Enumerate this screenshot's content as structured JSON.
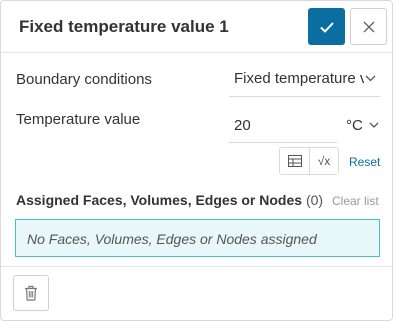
{
  "header": {
    "title": "Fixed temperature value 1"
  },
  "boundary_conditions": {
    "label": "Boundary conditions",
    "selected": "Fixed temperature v"
  },
  "temperature": {
    "label": "Temperature value",
    "value": "20",
    "unit": "°C"
  },
  "tools": {
    "reset_label": "Reset",
    "formula_symbol": "√x"
  },
  "assignment": {
    "title": "Assigned Faces, Volumes, Edges or Nodes",
    "count": "(0)",
    "clear_label": "Clear list",
    "empty_text": "No Faces, Volumes, Edges or Nodes assigned"
  },
  "colors": {
    "accent": "#0a6fa0",
    "assign_border": "#4bbcd2",
    "assign_fill": "#e8f7fa"
  }
}
